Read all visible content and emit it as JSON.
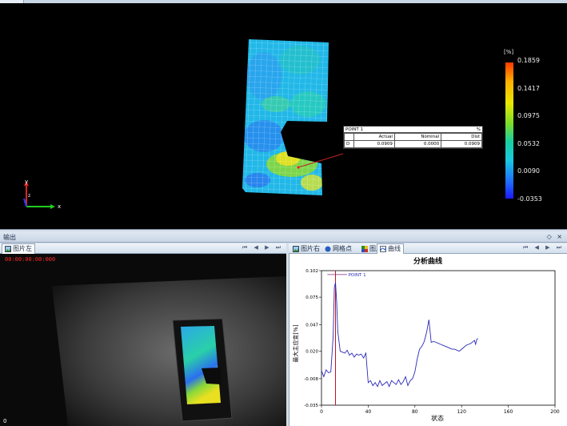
{
  "viewport": {
    "legend": {
      "unit": "[%]",
      "ticks": [
        "0.1859",
        "0.1417",
        "0.0975",
        "0.0532",
        "0.0090",
        "-0.0353"
      ],
      "colors": [
        "#ff3a00",
        "#ffb000",
        "#e8e800",
        "#7bdc2a",
        "#19cfa0",
        "#19c8e0",
        "#1f6bff",
        "#1a1aff"
      ]
    },
    "axes": {
      "x": "x",
      "y": "y",
      "z": "z"
    },
    "point_box": {
      "name": "POINT 1",
      "unit": "%",
      "headers": [
        "Actual",
        "Nominal",
        "Dist"
      ],
      "row_label": "D",
      "actual": "0.0909",
      "nominal": "0.0000",
      "dist": "0.0909"
    }
  },
  "output_bar": {
    "title": "输出",
    "pin": "◇ ×"
  },
  "left_tabs": {
    "label": "图片左",
    "navs": "⏮ ◀ ▶ ⏭"
  },
  "right_tabs": {
    "items": [
      "图片右",
      "网格点",
      "图片",
      "曲线"
    ],
    "navs": "⏮ ◀ ▶ ⏭"
  },
  "left_image": {
    "timestamp": "00:00:00:00:000",
    "frame": "0"
  },
  "chart_data": {
    "type": "line",
    "title": "分析曲线",
    "xlabel": "状态",
    "ylabel": "最大主应变[%]",
    "xlim": [
      0,
      200
    ],
    "ylim": [
      -0.035,
      0.102
    ],
    "xticks": [
      0,
      40,
      80,
      120,
      160,
      200
    ],
    "yticks": [
      "0.102",
      "0.075",
      "0.047",
      "0.020",
      "-0.008",
      "-0.035"
    ],
    "cursor_x": 12,
    "series": [
      {
        "name": "POINT 1",
        "x": [
          0,
          2,
          4,
          6,
          8,
          10,
          11,
          12,
          13,
          14,
          16,
          18,
          20,
          22,
          24,
          26,
          28,
          30,
          32,
          34,
          36,
          38,
          40,
          42,
          44,
          46,
          48,
          50,
          52,
          54,
          56,
          58,
          60,
          62,
          64,
          66,
          68,
          70,
          72,
          74,
          76,
          78,
          80,
          82,
          84,
          86,
          88,
          90,
          92,
          94,
          96,
          98,
          100,
          102,
          104,
          106,
          108,
          110,
          112,
          114,
          116,
          118,
          120,
          122,
          124,
          126,
          128,
          130,
          131,
          132,
          133,
          134
        ],
        "y": [
          0.0,
          -0.006,
          0.001,
          -0.002,
          -0.001,
          0.035,
          0.085,
          0.09,
          0.07,
          0.04,
          0.02,
          0.019,
          0.018,
          0.021,
          0.016,
          0.018,
          0.014,
          0.017,
          0.016,
          0.017,
          0.013,
          0.018,
          -0.012,
          -0.01,
          -0.015,
          -0.012,
          -0.016,
          -0.01,
          -0.015,
          -0.013,
          -0.011,
          -0.016,
          -0.01,
          -0.012,
          -0.014,
          -0.009,
          -0.014,
          -0.011,
          -0.006,
          -0.015,
          -0.01,
          -0.008,
          -0.001,
          0.012,
          0.022,
          0.025,
          0.03,
          0.039,
          0.052,
          0.029,
          0.03,
          0.029,
          0.028,
          0.027,
          0.026,
          0.025,
          0.024,
          0.023,
          0.022,
          0.022,
          0.021,
          0.02,
          0.022,
          0.024,
          0.026,
          0.027,
          0.028,
          0.03,
          0.031,
          0.027,
          0.032,
          0.033
        ]
      }
    ]
  }
}
